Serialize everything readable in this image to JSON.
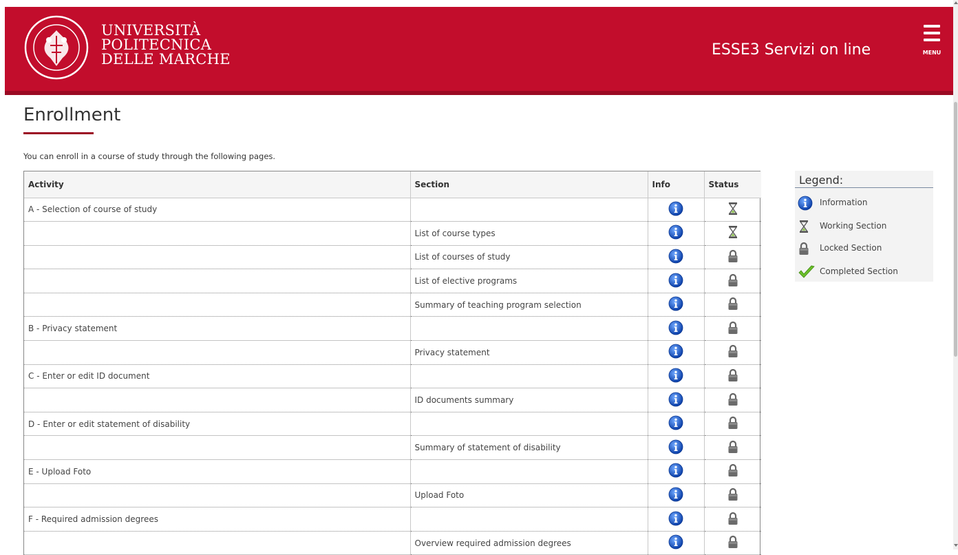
{
  "header": {
    "logo_lines": [
      "UNIVERSITÀ",
      "POLITECNICA",
      "DELLE MARCHE"
    ],
    "service_title": "ESSE3 Servizi on line",
    "menu_label": "MENU",
    "brand_color": "#c20d2c"
  },
  "page": {
    "title": "Enrollment",
    "intro": "You can enroll in a course of study through the following pages."
  },
  "table": {
    "columns": [
      "Activity",
      "Section",
      "Info",
      "Status"
    ],
    "rows": [
      {
        "activity": "A - Selection of course of study",
        "section": "",
        "status": "working"
      },
      {
        "activity": "",
        "section": "List of course types",
        "status": "working"
      },
      {
        "activity": "",
        "section": "List of courses of study",
        "status": "locked"
      },
      {
        "activity": "",
        "section": "List of elective programs",
        "status": "locked"
      },
      {
        "activity": "",
        "section": "Summary of teaching program selection",
        "status": "locked"
      },
      {
        "activity": "B - Privacy statement",
        "section": "",
        "status": "locked"
      },
      {
        "activity": "",
        "section": "Privacy statement",
        "status": "locked"
      },
      {
        "activity": "C - Enter or edit ID document",
        "section": "",
        "status": "locked"
      },
      {
        "activity": "",
        "section": "ID documents summary",
        "status": "locked"
      },
      {
        "activity": "D - Enter or edit statement of disability",
        "section": "",
        "status": "locked"
      },
      {
        "activity": "",
        "section": "Summary of statement of disability",
        "status": "locked"
      },
      {
        "activity": "E - Upload Foto",
        "section": "",
        "status": "locked"
      },
      {
        "activity": "",
        "section": "Upload Foto",
        "status": "locked"
      },
      {
        "activity": "F - Required admission degrees",
        "section": "",
        "status": "locked"
      },
      {
        "activity": "",
        "section": "Overview required admission degrees",
        "status": "locked"
      }
    ]
  },
  "legend": {
    "title": "Legend:",
    "items": [
      {
        "icon": "info-icon",
        "label": "Information"
      },
      {
        "icon": "hourglass-icon",
        "label": "Working Section"
      },
      {
        "icon": "lock-icon",
        "label": "Locked Section"
      },
      {
        "icon": "checkmark-icon",
        "label": "Completed Section"
      }
    ]
  }
}
